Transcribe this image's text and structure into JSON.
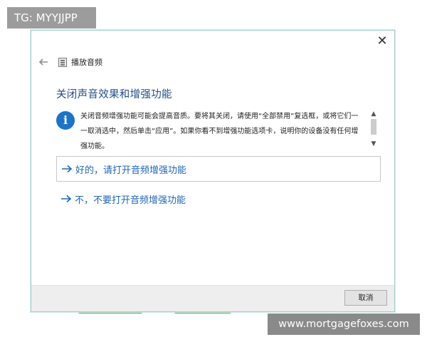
{
  "overlay": {
    "tag": "TG: MYYJJPP",
    "site": "www.mortgagefoxes.com"
  },
  "dialog": {
    "title": "播放音频",
    "heading": "关闭声音效果和增强功能",
    "info_text": "关闭音频增强功能可能会提高音质。要将其关闭，请使用“全部禁用”复选框，或将它们一一取消选中，然后单击“应用”。如果你看不到增强功能选项卡，说明你的设备没有任何增强功能。",
    "options": [
      {
        "label": "好的，请打开音频增强功能"
      },
      {
        "label": "不，不要打开音频增强功能"
      }
    ],
    "cancel_label": "取消"
  },
  "colors": {
    "heading": "#1f4d8b",
    "link": "#1e66b7",
    "info_icon": "#1b74c8"
  },
  "icons": {
    "back": "back-arrow-icon",
    "app": "audio-playback-icon",
    "info": "info-icon",
    "close": "close-icon"
  }
}
